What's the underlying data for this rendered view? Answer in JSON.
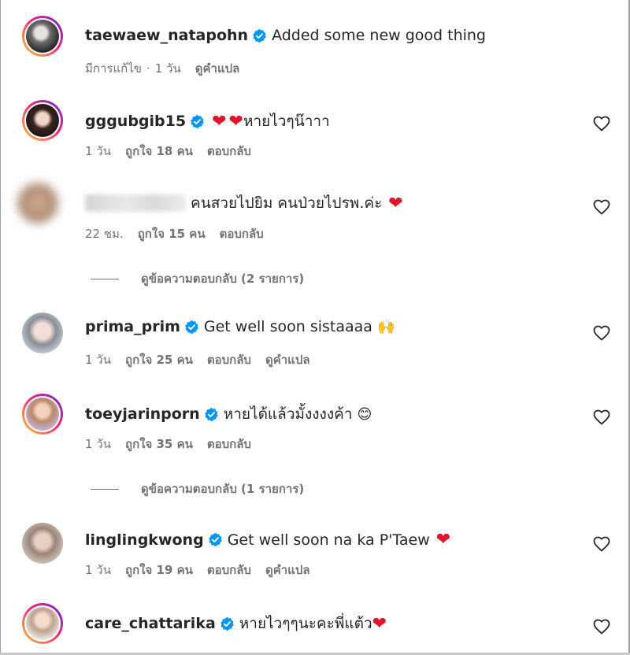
{
  "comments": [
    {
      "username": "taewaew_natapohn",
      "text": "Added some new good thing",
      "meta": [
        "มีการแก้ไข",
        "1 วัน"
      ],
      "translate": "ดูคำแปล"
    },
    {
      "username": "gggubgib15",
      "text": "หายไวๆน๊าาา",
      "time": "1 วัน",
      "likes": "ถูกใจ 18 คน",
      "reply": "ตอบกลับ"
    },
    {
      "username": "",
      "text": "คนสวยไปยิม คนป่วยไปรพ.ค่ะ",
      "time": "22 ชม.",
      "likes": "ถูกใจ 15 คน",
      "reply": "ตอบกลับ",
      "view_replies": "ดูข้อความตอบกลับ (2 รายการ)"
    },
    {
      "username": "prima_prim",
      "text": "Get well soon sistaaaa",
      "time": "1 วัน",
      "likes": "ถูกใจ 25 คน",
      "reply": "ตอบกลับ",
      "translate": "ดูคำแปล"
    },
    {
      "username": "toeyjarinporn",
      "text": "หายได้แล้วมั้งงงงค้า",
      "time": "1 วัน",
      "likes": "ถูกใจ 35 คน",
      "reply": "ตอบกลับ",
      "view_replies": "ดูข้อความตอบกลับ (1 รายการ)"
    },
    {
      "username": "linglingkwong",
      "text": "Get well soon na ka P'Taew",
      "time": "1 วัน",
      "likes": "ถูกใจ 19 คน",
      "reply": "ตอบกลับ",
      "translate": "ดูคำแปล"
    },
    {
      "username": "care_chattarika",
      "text": "หายไวๆๆนะคะพี่แต้ว"
    }
  ],
  "emoji": {
    "heart": "❤",
    "praying": "🙌",
    "smile": "😊"
  },
  "icons": {
    "like": "heart-outline-icon",
    "verified": "verified-badge-icon"
  },
  "colors": {
    "verified": "#0095f6",
    "meta_text": "#737373",
    "heart": "#e0152b"
  }
}
